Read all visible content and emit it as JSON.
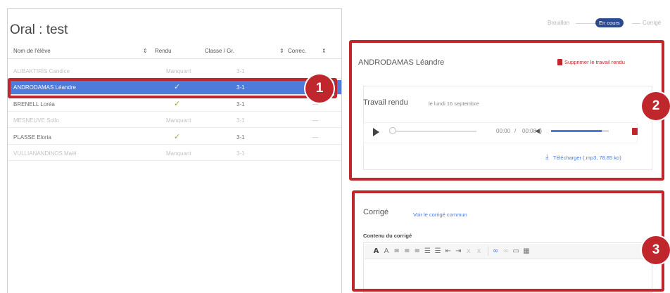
{
  "page": {
    "title": "Oral : test"
  },
  "status_steps": [
    {
      "label": "Brouillon",
      "active": false
    },
    {
      "label": "En cours",
      "active": true
    },
    {
      "label": "Corrigé",
      "active": false
    }
  ],
  "table": {
    "headers": {
      "name": "Nom de l'élève",
      "rendu": "Rendu",
      "classe": "Classe / Gr.",
      "correc": "Correc."
    },
    "rows": [
      {
        "name": "ALIBAKTIRIS Candice",
        "rendu": "Manquant",
        "classe": "3-1",
        "correc": "",
        "state": "faded"
      },
      {
        "name": "ANDRODAMAS Léandre",
        "rendu": "✓",
        "classe": "3-1",
        "correc": "",
        "state": "selected"
      },
      {
        "name": "BRENELL Loréa",
        "rendu": "✓",
        "classe": "3-1",
        "correc": "—",
        "state": "normal"
      },
      {
        "name": "MESNEUVE Sollo",
        "rendu": "Manquant",
        "classe": "3-1",
        "correc": "—",
        "state": "faded"
      },
      {
        "name": "PLASSE Eloria",
        "rendu": "✓",
        "classe": "3-1",
        "correc": "—",
        "state": "normal"
      },
      {
        "name": "VULLIANANDINOS Maël",
        "rendu": "Manquant",
        "classe": "3-1",
        "correc": "",
        "state": "faded"
      }
    ]
  },
  "student_panel": {
    "name": "ANDRODAMAS Léandre",
    "delete_label": "Supprimer le travail rendu",
    "work_title": "Travail rendu",
    "work_date": "le lundi 16 septembre",
    "time_current": "00:00",
    "time_separator": "/",
    "time_total": "00:08",
    "download_label": "Télécharger (.mp3, 78.85 ko)"
  },
  "corrige_panel": {
    "title": "Corrigé",
    "link": "Voir le corrigé commun",
    "content_label": "Contenu du corrigé"
  },
  "badges": [
    "1",
    "2",
    "3"
  ],
  "colors": {
    "highlight": "#c0272d",
    "selected_row": "#4c7bd9",
    "accent": "#2c4a8f",
    "check": "#8fb23a"
  },
  "icons": [
    "play-icon",
    "volume-icon",
    "trash-icon",
    "download-icon",
    "sort-icon",
    "check-icon"
  ]
}
